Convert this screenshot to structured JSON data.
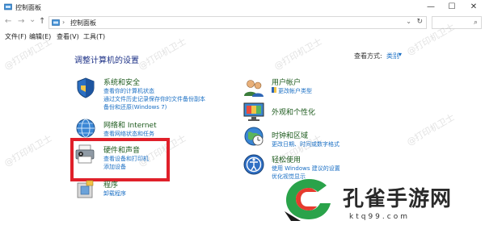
{
  "window": {
    "title": "控制面板",
    "minimize_label": "—",
    "maximize_label": "☐",
    "close_label": "✕"
  },
  "nav": {
    "back_label": "←",
    "forward_label": "→",
    "recent_label": "⌄",
    "up_label": "↑",
    "address_sep": "›",
    "address_text": "控制面板",
    "address_drop": "⌄",
    "refresh_label": "↻",
    "search_icon_label": "⌕"
  },
  "menu": {
    "items": [
      "文件(F)",
      "编辑(E)",
      "查看(V)",
      "工具(T)"
    ]
  },
  "main": {
    "heading": "调整计算机的设置",
    "view_by_label": "查看方式:",
    "view_by_value": "类别",
    "view_by_caret": "▾"
  },
  "categories_left": [
    {
      "title": "系统和安全",
      "links": [
        "查看你的计算机状态",
        "通过文件历史记录保存你的文件备份副本",
        "备份和还原(Windows 7)"
      ]
    },
    {
      "title": "网络和 Internet",
      "links": [
        "查看网络状态和任务"
      ]
    },
    {
      "title": "硬件和声音",
      "links": [
        "查看设备和打印机",
        "添加设备"
      ]
    },
    {
      "title": "程序",
      "links": [
        "卸载程序"
      ]
    }
  ],
  "categories_right": [
    {
      "title": "用户帐户",
      "links": [
        "更改帐户类型"
      ]
    },
    {
      "title": "外观和个性化",
      "links": []
    },
    {
      "title": "时钟和区域",
      "links": [
        "更改日期、时间或数字格式"
      ]
    },
    {
      "title": "轻松使用",
      "links": [
        "使用 Windows 建议的设置",
        "优化视觉显示"
      ]
    }
  ],
  "watermark_text": "@打印机卫士",
  "promo": {
    "name": "孔雀手游网",
    "url": "ktq99.com"
  },
  "colors": {
    "highlight": "#e0202a",
    "link": "#1a6fc4",
    "heading": "#1e3287",
    "category_title": "#1e5b1e"
  }
}
